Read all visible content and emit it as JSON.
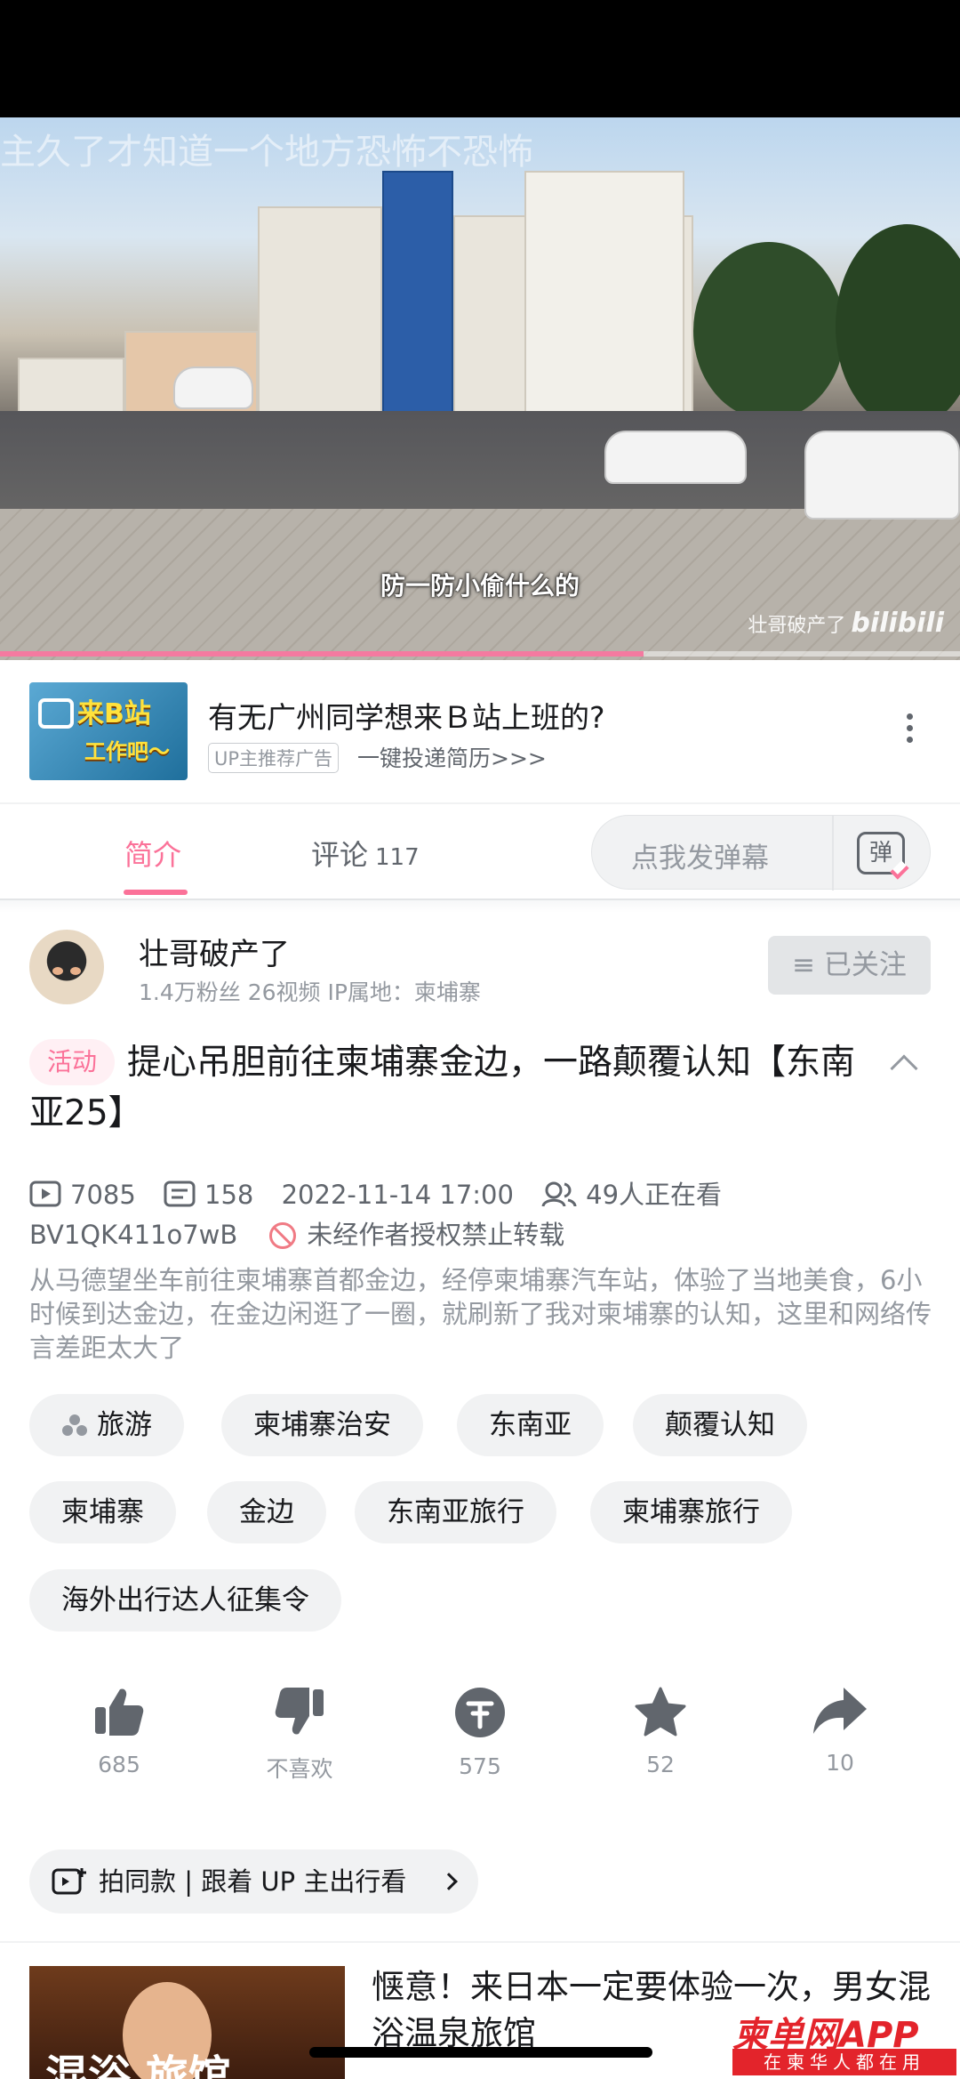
{
  "video": {
    "overlay_title": "主久了才知道一个地方恐怖不恐怖",
    "subtitle": "防一防小偷什么的",
    "watermark_user": "壮哥破产了",
    "watermark_logo": "bilibili",
    "progress": 0.67
  },
  "ad": {
    "thumb_line1": "来B站",
    "thumb_line2": "工作吧～",
    "title": "有无广州同学想来Ｂ站上班的?",
    "badge": "UP主推荐广告",
    "subtitle": "一键投递简历>>>"
  },
  "tabs": {
    "intro": "简介",
    "comments": "评论",
    "comment_count": "117",
    "danmaku_placeholder": "点我发弹幕",
    "danmaku_icon_text": "弹"
  },
  "uploader": {
    "name": "壮哥破产了",
    "meta": "1.4万粉丝  26视频  IP属地：柬埔寨",
    "follow_label": "≡ 已关注"
  },
  "video_info": {
    "activity_tag": "活动",
    "title": "提心吊胆前往柬埔寨金边，一路颠覆认知【东南亚25】",
    "views": "7085",
    "danmaku": "158",
    "date": "2022-11-14 17:00",
    "watching": "49人正在看",
    "bvid": "BV1QK411o7wB",
    "copyright": "未经作者授权禁止转载",
    "description": "从马德望坐车前往柬埔寨首都金边，经停柬埔寨汽车站，体验了当地美食，6小时候到达金边，在金边闲逛了一圈，就刷新了我对柬埔寨的认知，这里和网络传言差距太大了"
  },
  "tags": [
    "旅游",
    "柬埔寨治安",
    "东南亚",
    "颠覆认知",
    "柬埔寨",
    "金边",
    "东南亚旅行",
    "柬埔寨旅行",
    "海外出行达人征集令"
  ],
  "actions": {
    "like": "685",
    "dislike": "不喜欢",
    "coin": "575",
    "favorite": "52",
    "share": "10"
  },
  "same_style": "拍同款 | 跟着 UP 主出行看",
  "recommend": {
    "title": "惬意！来日本一定要体验一次，男女混浴温泉旅馆",
    "thumb_caption": "混浴 旅馆"
  },
  "brand": {
    "logo": "柬单网APP",
    "slogan": "在柬华人都在用"
  }
}
